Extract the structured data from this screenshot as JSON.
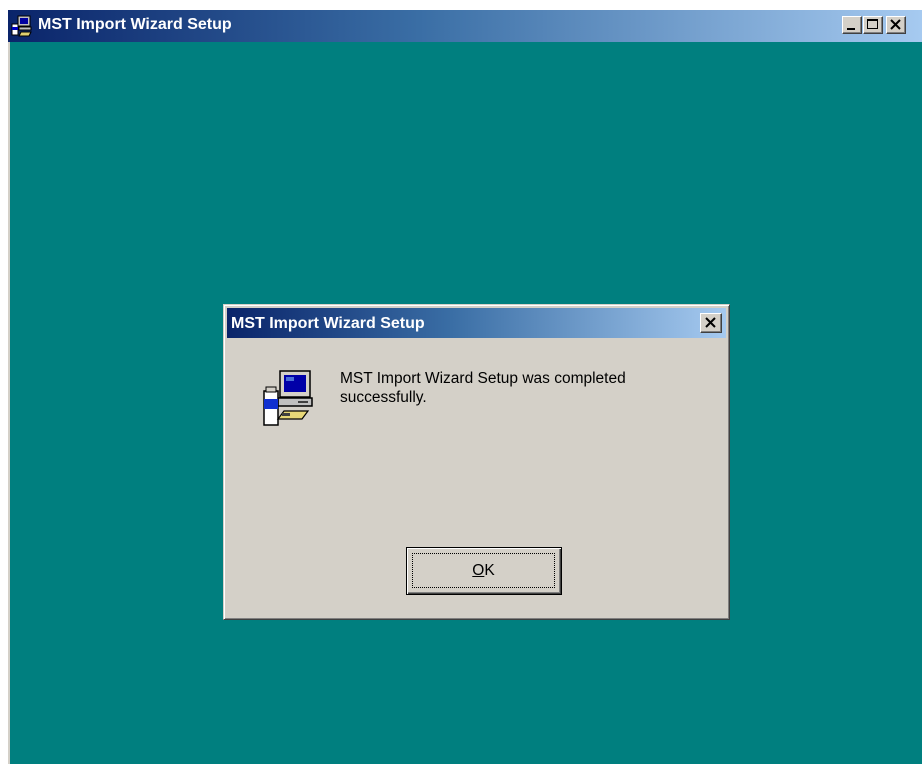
{
  "main_window": {
    "title": "MST Import Wizard Setup",
    "icon": "setup-computer-icon",
    "controls": {
      "minimize": "minimize-icon",
      "maximize": "maximize-icon",
      "close": "close-icon"
    }
  },
  "desktop": {
    "background_color": "#007f7f"
  },
  "dialog": {
    "title": "MST Import Wizard Setup",
    "close_icon": "close-icon",
    "icon": "setup-computer-icon",
    "message": "MST Import Wizard Setup was completed successfully.",
    "ok_button": {
      "mnemonic": "O",
      "rest": "K"
    }
  },
  "colors": {
    "title_bar_start": "#0a246a",
    "title_bar_end": "#a6caf0",
    "face": "#d4d0c8"
  }
}
